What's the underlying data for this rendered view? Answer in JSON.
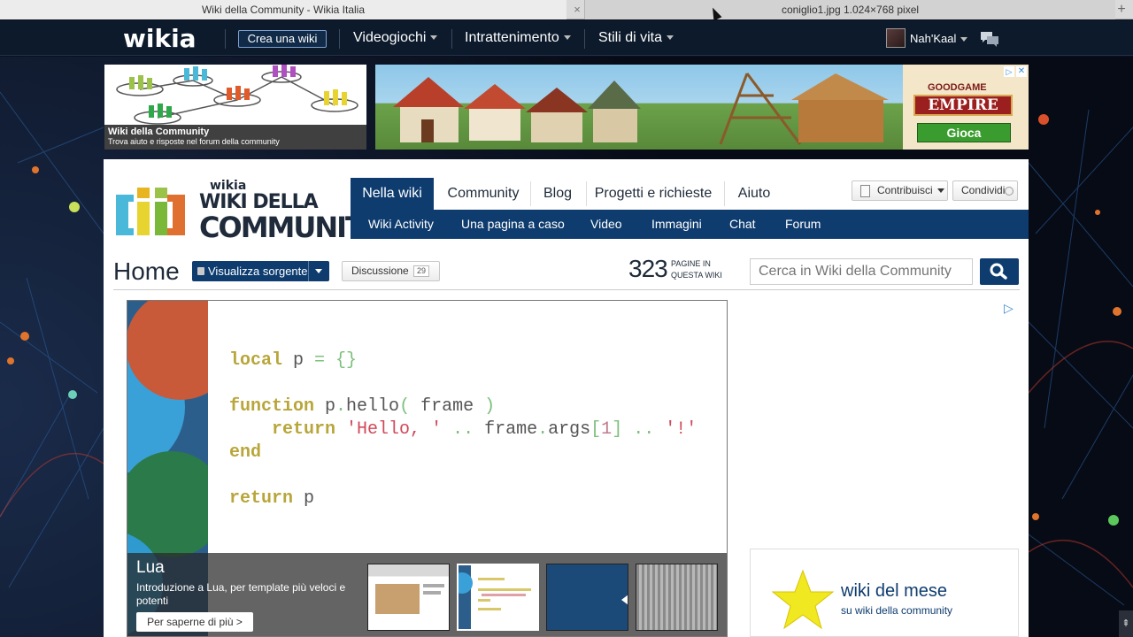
{
  "browser": {
    "active_tab": "Wiki della Community - Wikia Italia",
    "inactive_tab": "coniglio1.jpg 1.024×768 pixel",
    "close_glyph": "×",
    "new_tab_glyph": "+"
  },
  "global_nav": {
    "logo": "wikia",
    "create_wiki": "Crea una wiki",
    "items": [
      "Videogiochi",
      "Intrattenimento",
      "Stili di vita"
    ],
    "username": "Nah'Kaal"
  },
  "ads": {
    "community_title": "Wiki della Community",
    "community_subtitle": "Trova aiuto e risposte nel forum della community",
    "game_brand_top": "GOODGAME",
    "game_brand_main": "EMPIRE",
    "game_button": "Gioca"
  },
  "wiki": {
    "logo_small": "wikia",
    "logo_line1": "WIKI DELLA",
    "logo_line2": "COMMUNITY",
    "tabs": [
      "Nella wiki",
      "Community",
      "Blog",
      "Progetti e richieste",
      "Aiuto"
    ],
    "subnav": [
      "Wiki Activity",
      "Una pagina a caso",
      "Video",
      "Immagini",
      "Chat",
      "Forum"
    ],
    "contribute": "Contribuisci",
    "share": "Condividi"
  },
  "page": {
    "title": "Home",
    "view_source": "Visualizza sorgente",
    "discussion": "Discussione",
    "discussion_count": "29",
    "page_count": "323",
    "page_count_label": "PAGINE IN QUESTA WIKI",
    "search_placeholder": "Cerca in Wiki della Community"
  },
  "slider": {
    "title": "Lua",
    "description": "Introduzione a Lua, per template più veloci e potenti",
    "button": "Per saperne di più >"
  },
  "rail": {
    "wotm_title": "wiki del mese",
    "wotm_subtitle": "su wiki della community"
  },
  "colors": {
    "nav_dark": "#0c1a2b",
    "wiki_blue": "#0e3c6f",
    "code_keyword": "#b8a63a",
    "code_string": "#d04a5a"
  }
}
